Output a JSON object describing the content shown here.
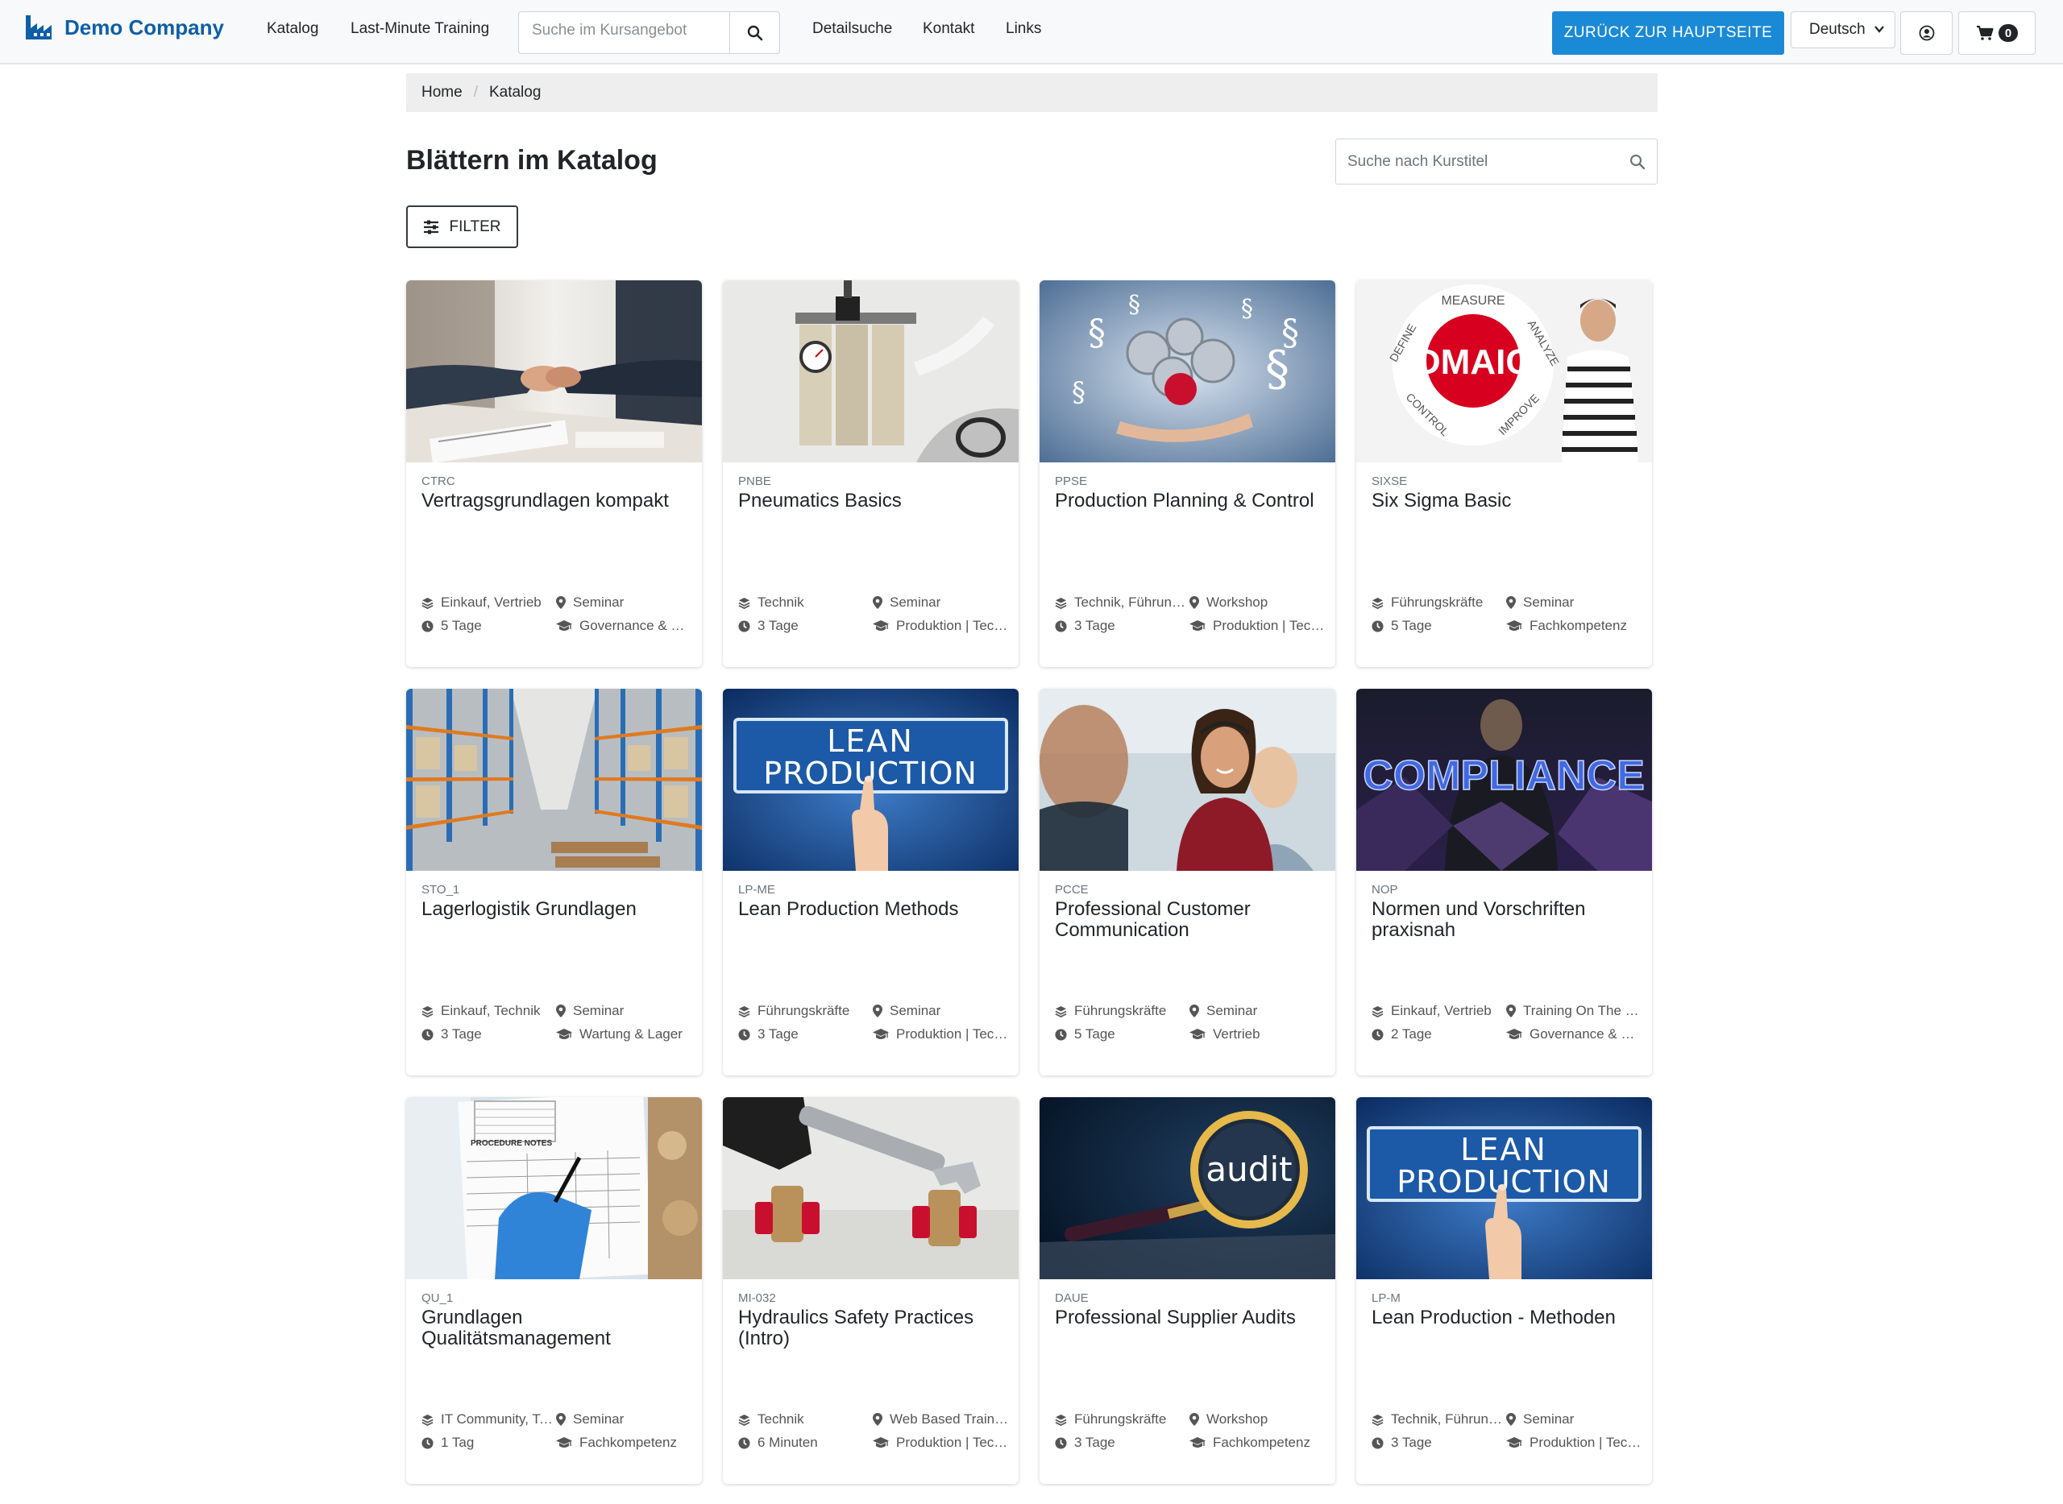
{
  "nav": {
    "brand": "Demo Company",
    "links": [
      "Katalog",
      "Last-Minute Training"
    ],
    "search_placeholder": "Suche im Kursangebot",
    "links2": [
      "Detailsuche",
      "Kontakt",
      "Links"
    ],
    "back_button": "Zurück zur Hauptseite",
    "language": "Deutsch",
    "cart_count": "0"
  },
  "breadcrumb": [
    "Home",
    "Katalog"
  ],
  "page_title": "Blättern im Katalog",
  "title_search_placeholder": "Suche nach Kurstitel",
  "filter_label": "FILTER",
  "icons": {
    "brand": "factory-icon",
    "search": "search-icon",
    "user": "user-circle-icon",
    "cart": "cart-icon",
    "filter": "sliders-icon",
    "category": "layers-icon",
    "location": "map-marker-icon",
    "duration": "clock-icon",
    "target": "graduation-cap-icon"
  },
  "colors": {
    "brand": "#0e5fa6",
    "primary": "#1b8ad6"
  },
  "courses": [
    {
      "code": "CTRC",
      "title": "Vertragsgrundlagen kompakt",
      "category": "Einkauf, Vertrieb",
      "format": "Seminar",
      "duration": "5 Tage",
      "target": "Governance & Compliance",
      "image": "handshake"
    },
    {
      "code": "PNBE",
      "title": "Pneumatics Basics",
      "category": "Technik",
      "format": "Seminar",
      "duration": "3 Tage",
      "target": "Produktion | Technik",
      "image": "pneumatic-unit"
    },
    {
      "code": "PPSE",
      "title": "Production Planning & Control",
      "category": "Technik, Führungskräfte",
      "format": "Workshop",
      "duration": "3 Tage",
      "target": "Produktion | Technik",
      "image": "gears-on-hand"
    },
    {
      "code": "SIXSE",
      "title": "Six Sigma Basic",
      "category": "Führungskräfte",
      "format": "Seminar",
      "duration": "5 Tage",
      "target": "Fachkompetenz",
      "image": "dmaic"
    },
    {
      "code": "STO_1",
      "title": "Lagerlogistik Grundlagen",
      "category": "Einkauf, Technik",
      "format": "Seminar",
      "duration": "3 Tage",
      "target": "Wartung & Lager",
      "image": "warehouse"
    },
    {
      "code": "LP-ME",
      "title": "Lean Production Methods",
      "category": "Führungskräfte",
      "format": "Seminar",
      "duration": "3 Tage",
      "target": "Produktion | Technik",
      "image": "lean-production"
    },
    {
      "code": "PCCE",
      "title": "Professional Customer Communication",
      "category": "Führungskräfte",
      "format": "Seminar",
      "duration": "5 Tage",
      "target": "Vertrieb",
      "image": "call-center"
    },
    {
      "code": "NOP",
      "title": "Normen und Vorschriften praxisnah",
      "category": "Einkauf, Vertrieb",
      "format": "Training On The Job",
      "duration": "2 Tage",
      "target": "Governance & Compliance",
      "image": "compliance"
    },
    {
      "code": "QU_1",
      "title": "Grundlagen Qualitätsmanagement",
      "category": "IT Community, Technik",
      "format": "Seminar",
      "duration": "1 Tag",
      "target": "Fachkompetenz",
      "image": "procedure-notes"
    },
    {
      "code": "MI-032",
      "title": "Hydraulics Safety Practices (Intro)",
      "category": "Technik",
      "format": "Web Based Training",
      "duration": "6 Minuten",
      "target": "Produktion | Technik",
      "image": "wrench-valves"
    },
    {
      "code": "DAUE",
      "title": "Professional Supplier Audits",
      "category": "Führungskräfte",
      "format": "Workshop",
      "duration": "3 Tage",
      "target": "Fachkompetenz",
      "image": "audit-magnifier"
    },
    {
      "code": "LP-M",
      "title": "Lean Production - Methoden",
      "category": "Technik, Führungskräfte",
      "format": "Seminar",
      "duration": "3 Tage",
      "target": "Produktion | Technik",
      "image": "lean-production"
    }
  ],
  "image_texts": {
    "dmaic": "DMAIC",
    "dmaic_ring": [
      "DEFINE",
      "MEASURE",
      "ANALYZE",
      "IMPROVE",
      "CONTROL"
    ],
    "lean_1": "LEAN",
    "lean_2": "PRODUCTION",
    "compliance": "COMPLIANCE",
    "audit": "audit",
    "procedure": "PROCEDURE NOTES"
  }
}
